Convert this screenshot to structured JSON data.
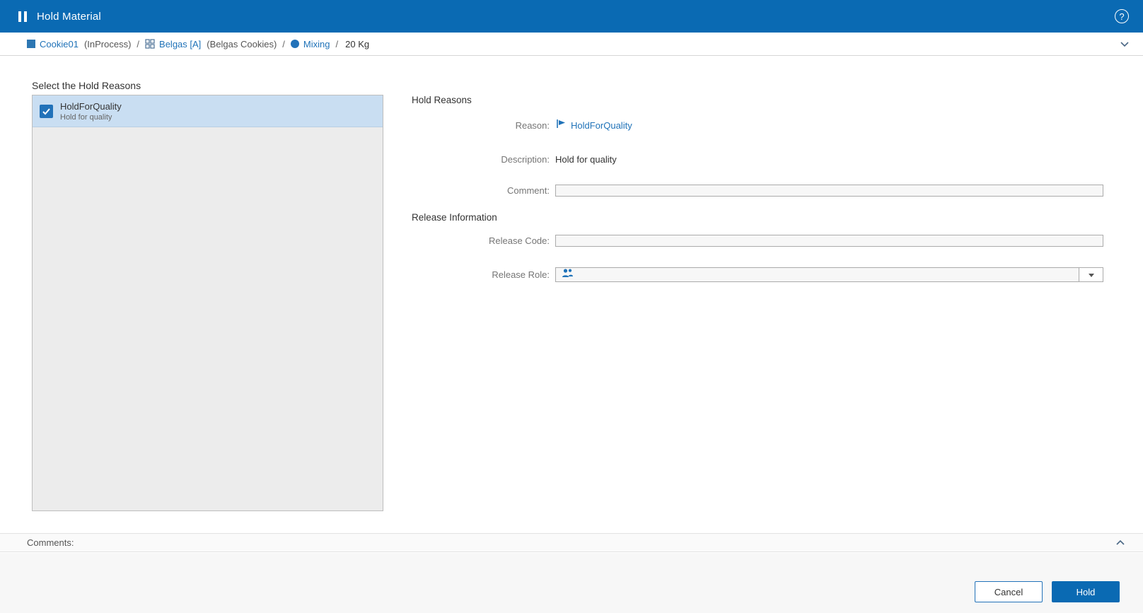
{
  "colors": {
    "header_bg": "#0a6ab3",
    "accent": "#0a6ab3",
    "link": "#1f72b8",
    "selected_row_bg": "#c9def2",
    "hold_button_bg": "#0a6ab3"
  },
  "header": {
    "title": "Hold Material",
    "help_glyph": "?"
  },
  "breadcrumb": {
    "separator": "/",
    "material_name": "Cookie01",
    "material_state": "(InProcess)",
    "product_name": "Belgas [A]",
    "product_desc": "(Belgas Cookies)",
    "step_name": "Mixing",
    "quantity": "20 Kg"
  },
  "reason_list": {
    "title": "Select the Hold Reasons",
    "items": [
      {
        "name": "HoldForQuality",
        "description": "Hold for quality",
        "checked": true
      }
    ]
  },
  "form": {
    "section1_title": "Hold Reasons",
    "reason_label": "Reason:",
    "reason_value": "HoldForQuality",
    "description_label": "Description:",
    "description_value": "Hold for quality",
    "comment_label": "Comment:",
    "comment_value": "",
    "section2_title": "Release Information",
    "release_code_label": "Release Code:",
    "release_code_value": "",
    "release_role_label": "Release Role:",
    "release_role_value": ""
  },
  "comments_bar": {
    "label": "Comments:"
  },
  "footer": {
    "cancel_label": "Cancel",
    "hold_label": "Hold"
  }
}
